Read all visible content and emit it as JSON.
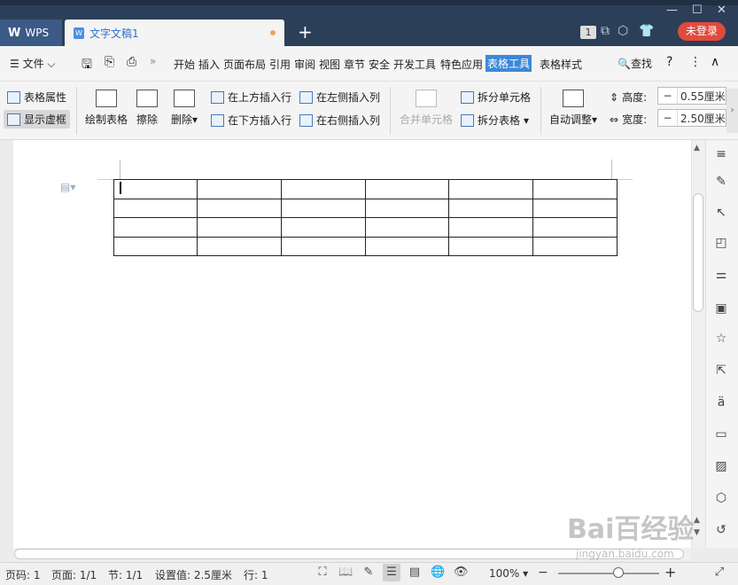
{
  "titlebar": {
    "app_tab": "WPS",
    "doc_tab": "文字文稿1",
    "doc_tab_icon": "W",
    "new_tab": "+",
    "window_count": "1",
    "login_button": "未登录",
    "icons": [
      "hexagon-icon",
      "shirt-icon",
      "minimize-icon",
      "maximize-icon",
      "close-icon"
    ]
  },
  "menu": {
    "file": "文件",
    "items": [
      "开始",
      "插入",
      "页面布局",
      "引用",
      "审阅",
      "视图",
      "章节",
      "安全",
      "开发工具",
      "特色应用",
      "表格工具",
      "表格样式"
    ],
    "active": "表格工具",
    "search": "查找",
    "help": "?",
    "more": "⋮",
    "collapse": "∧"
  },
  "ribbon": {
    "table_props": "表格属性",
    "show_gridlines": "显示虚框",
    "draw_table": "绘制表格",
    "erase": "擦除",
    "delete": "删除",
    "insert_row_above": "在上方插入行",
    "insert_row_below": "在下方插入行",
    "insert_col_left": "在左侧插入列",
    "insert_col_right": "在右侧插入列",
    "merge_cells": "合并单元格",
    "split_cells": "拆分单元格",
    "split_table": "拆分表格",
    "auto_fit": "自动调整",
    "height_label": "高度:",
    "height_value": "0.55厘米",
    "width_label": "宽度:",
    "width_value": "2.50厘米",
    "minus": "−"
  },
  "table": {
    "rows": 4,
    "cols": 6
  },
  "statusbar": {
    "page_num": "页码: 1",
    "pages": "页面: 1/1",
    "section": "节: 1/1",
    "setting": "设置值: 2.5厘米",
    "line": "行: 1",
    "zoom": "100%",
    "zoom_minus": "−",
    "zoom_plus": "+"
  },
  "watermark": {
    "text": "Bai百经验",
    "url": "jingyan.baidu.com"
  },
  "colors": {
    "titlebar": "#2c3f58",
    "active_tab": "#3d87d8",
    "login": "#e04a3c"
  }
}
